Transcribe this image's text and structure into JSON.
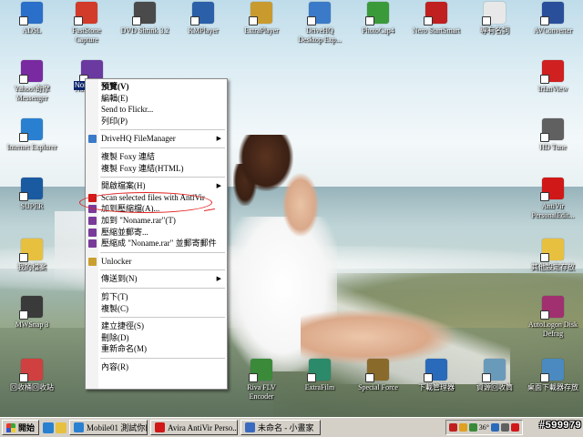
{
  "desktop_icons": [
    {
      "label": "ADSL",
      "icon": "network-connection-icon",
      "color": "#2a6fc9"
    },
    {
      "label": "FastStone\nCapture",
      "icon": "faststone-capture-icon",
      "color": "#d23a2a"
    },
    {
      "label": "DVD Shrink 3.2",
      "icon": "dvd-shrink-icon",
      "color": "#4a4a4a"
    },
    {
      "label": "KMPlayer",
      "icon": "kmplayer-icon",
      "color": "#2b5fa8"
    },
    {
      "label": "ExtraPlayer",
      "icon": "extraplayer-icon",
      "color": "#c99a2e"
    },
    {
      "label": "DriveHQ\nDesktop Exp...",
      "icon": "drivehq-icon",
      "color": "#3b7ac8"
    },
    {
      "label": "PhotoCap4",
      "icon": "photocap-icon",
      "color": "#3a9a3a"
    },
    {
      "label": "Nero StartSmart",
      "icon": "nero-icon",
      "color": "#c02020"
    },
    {
      "label": "專有名詞",
      "icon": "document-icon",
      "color": "#e8e8e8"
    },
    {
      "label": "AVConverter",
      "icon": "avconverter-icon",
      "color": "#2a4f9a"
    },
    {
      "label": "Yahoo!奇摩\nMessenger",
      "icon": "yahoo-messenger-icon",
      "color": "#7a2aa0"
    },
    {
      "label": "Noname.rar",
      "icon": "rar-archive-icon",
      "color": "#6a3aa0"
    },
    {
      "label": "IrfanView",
      "icon": "irfanview-icon",
      "color": "#d02020"
    },
    {
      "label": "Internet Explorer",
      "icon": "internet-explorer-icon",
      "color": "#2a80d0"
    },
    {
      "label": "HD Tune",
      "icon": "hd-tune-icon",
      "color": "#606060"
    },
    {
      "label": "SUPER",
      "icon": "super-icon",
      "color": "#1a5aa0"
    },
    {
      "label": "AntiVir\nPersonalEdit...",
      "icon": "antivir-icon",
      "color": "#d01818"
    },
    {
      "label": "我的檔案",
      "icon": "my-documents-icon",
      "color": "#e8c040"
    },
    {
      "label": "其他設定存放",
      "icon": "folder-icon",
      "color": "#e8c040"
    },
    {
      "label": "MWSnap 3",
      "icon": "mwsnap-icon",
      "color": "#3a3a3a"
    },
    {
      "label": "AutoLogon Disk\nDefrag",
      "icon": "defrag-icon",
      "color": "#a03070"
    },
    {
      "label": "回收桶回收站",
      "icon": "recycle-bin-icon",
      "color": "#d04040"
    },
    {
      "label": "Riva FLV\nEncoder",
      "icon": "riva-flv-icon",
      "color": "#3a8a3a"
    },
    {
      "label": "ExtraFilm",
      "icon": "extrafilm-icon",
      "color": "#2a8a6a"
    },
    {
      "label": "Special Force",
      "icon": "special-force-icon",
      "color": "#8a6a2a"
    },
    {
      "label": "下載管理器",
      "icon": "download-manager-icon",
      "color": "#2a6aba"
    },
    {
      "label": "資源回收筒",
      "icon": "recycle-bin-icon",
      "color": "#6a9aba"
    },
    {
      "label": "桌面下載器存放",
      "icon": "folder-icon",
      "color": "#4a8ac0"
    }
  ],
  "context_menu": {
    "items": [
      {
        "label": "預覽(V)",
        "bold": true
      },
      {
        "label": "編輯(E)"
      },
      {
        "label": "Send to Flickr..."
      },
      {
        "label": "列印(P)"
      },
      {
        "sep": true
      },
      {
        "label": "DriveHQ FileManager",
        "submenu": true,
        "icon": "drivehq-icon",
        "icon_color": "#3b7ac8"
      },
      {
        "sep": true
      },
      {
        "label": "複製 Foxy 連結"
      },
      {
        "label": "複製 Foxy 連結(HTML)"
      },
      {
        "sep": true
      },
      {
        "label": "開啟檔案(H)",
        "submenu": true
      },
      {
        "label": "Scan selected files with AntiVir",
        "icon": "antivir-icon",
        "icon_color": "#d01818"
      },
      {
        "label": "加到壓縮檔(A)...",
        "icon": "winrar-icon",
        "icon_color": "#7a3a9a"
      },
      {
        "label": "加到 \"Noname.rar\"(T)",
        "icon": "winrar-icon",
        "icon_color": "#7a3a9a"
      },
      {
        "label": "壓縮並郵寄...",
        "icon": "winrar-icon",
        "icon_color": "#7a3a9a"
      },
      {
        "label": "壓縮成 \"Noname.rar\" 並郵寄郵件",
        "icon": "winrar-icon",
        "icon_color": "#7a3a9a"
      },
      {
        "sep": true
      },
      {
        "label": "Unlocker",
        "icon": "unlocker-icon",
        "icon_color": "#c9a030"
      },
      {
        "sep": true
      },
      {
        "label": "傳送到(N)",
        "submenu": true
      },
      {
        "sep": true
      },
      {
        "label": "剪下(T)"
      },
      {
        "label": "複製(C)"
      },
      {
        "sep": true
      },
      {
        "label": "建立捷徑(S)"
      },
      {
        "label": "刪除(D)"
      },
      {
        "label": "重新命名(M)"
      },
      {
        "sep": true
      },
      {
        "label": "內容(R)"
      }
    ]
  },
  "selected_icon_label": "Nona",
  "taskbar": {
    "start_label": "開始",
    "tasks": [
      {
        "label": "Mobile01 測試你的...",
        "icon": "ie-window-icon",
        "color": "#2a80d0"
      },
      {
        "label": "Avira AntiVir Perso...",
        "icon": "antivir-icon",
        "color": "#d01818"
      },
      {
        "label": "未命名 - 小畫家",
        "icon": "paint-icon",
        "color": "#3a6ac0"
      }
    ],
    "tray_temp": "36°",
    "watermark": "#599979"
  }
}
